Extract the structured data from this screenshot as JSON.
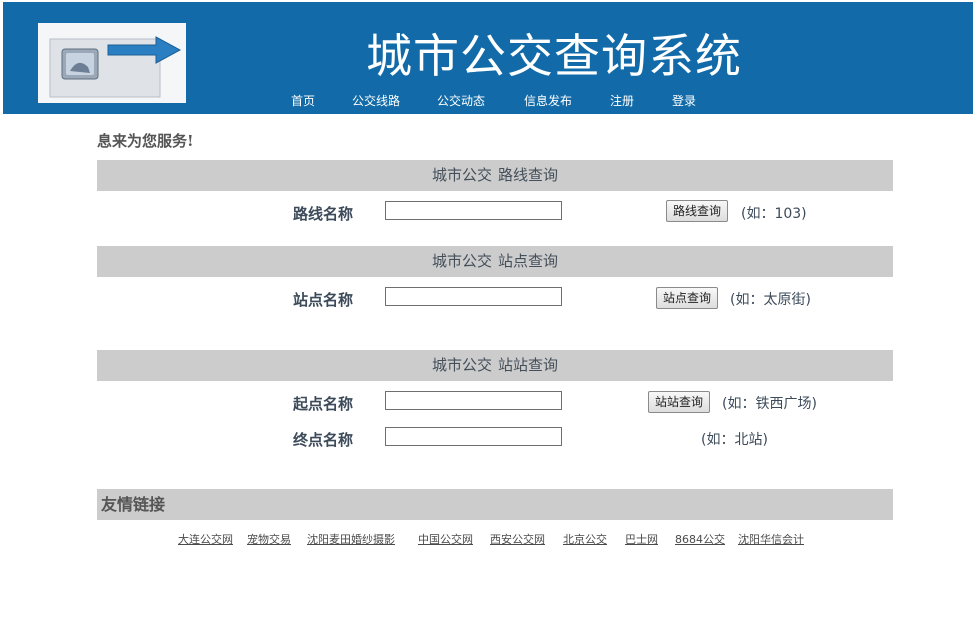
{
  "header": {
    "title": "城市公交查询系统",
    "nav": [
      "首页",
      "公交线路",
      "公交动态",
      "信息发布",
      "注册",
      "登录"
    ]
  },
  "welcome": "息来为您服务!",
  "route_section": {
    "bar_prefix": "城市公交",
    "bar_title": "路线查询",
    "label": "路线名称",
    "value": "",
    "button": "路线查询",
    "hint": "(如：103)"
  },
  "stop_section": {
    "bar_prefix": "城市公交",
    "bar_title": "站点查询",
    "label": "站点名称",
    "value": "",
    "button": "站点查询",
    "hint": "(如：太原街)"
  },
  "transfer_section": {
    "bar_prefix": "城市公交",
    "bar_title": "站站查询",
    "start_label": "起点名称",
    "start_value": "",
    "button": "站站查询",
    "start_hint": "(如：铁西广场)",
    "end_label": "终点名称",
    "end_value": "",
    "end_hint": "(如：北站)"
  },
  "friend_links": {
    "title": "友情链接",
    "items": [
      "大连公交网",
      "宠物交易",
      "沈阳麦田婚纱摄影",
      "中国公交网",
      "西安公交网",
      "北京公交",
      "巴士网",
      "8684公交",
      "沈阳华信会计"
    ]
  },
  "colors": {
    "header_bg": "#126ba8",
    "section_bar": "#cccccc"
  }
}
